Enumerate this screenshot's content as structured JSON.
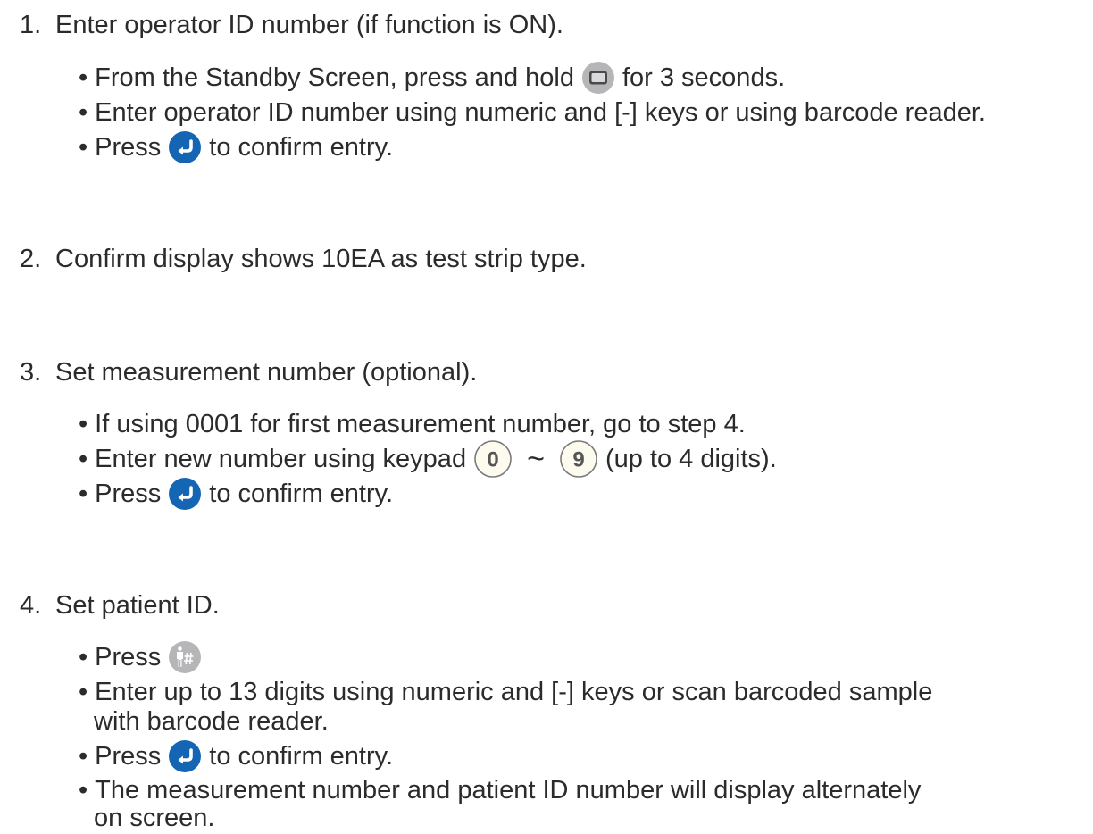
{
  "steps": [
    {
      "num": "1.",
      "title": "Enter operator ID number (if function is ON).",
      "bullets": [
        {
          "before": "From the Standby Screen, press and hold",
          "after": "for 3 seconds."
        },
        {
          "text": "Enter operator ID number using numeric and [-] keys or using barcode reader."
        },
        {
          "before": "Press",
          "after": "to confirm entry."
        }
      ]
    },
    {
      "num": "2.",
      "title": "Confirm display shows 10EA as test strip type."
    },
    {
      "num": "3.",
      "title": "Set measurement number (optional).",
      "bullets": [
        {
          "text": "If using 0001 for first measurement number, go to step 4."
        },
        {
          "before": "Enter new number using keypad",
          "key_from": "0",
          "range_sep": "~",
          "key_to": "9",
          "after": "(up to 4 digits)."
        },
        {
          "before": "Press",
          "after": "to confirm entry."
        }
      ]
    },
    {
      "num": "4.",
      "title": "Set patient ID.",
      "bullets": [
        {
          "before": "Press"
        },
        {
          "line1": "Enter up to 13 digits using numeric and [-] keys or scan barcoded sample",
          "line2": "with barcode reader."
        },
        {
          "before": "Press",
          "after": "to confirm entry."
        },
        {
          "line1": "The measurement number and patient ID number will display alternately",
          "line2": "on screen."
        }
      ]
    }
  ],
  "bullet_char": "•",
  "icons": {
    "display_button": "display-button-icon",
    "enter_button": "enter-button-icon",
    "patient_id_button": "patient-id-button-icon"
  },
  "colors": {
    "text": "#2b2b2b",
    "enter_blue": "#1565b5",
    "gray_button": "#b6b6b9",
    "key_fill": "#fdfbee"
  }
}
